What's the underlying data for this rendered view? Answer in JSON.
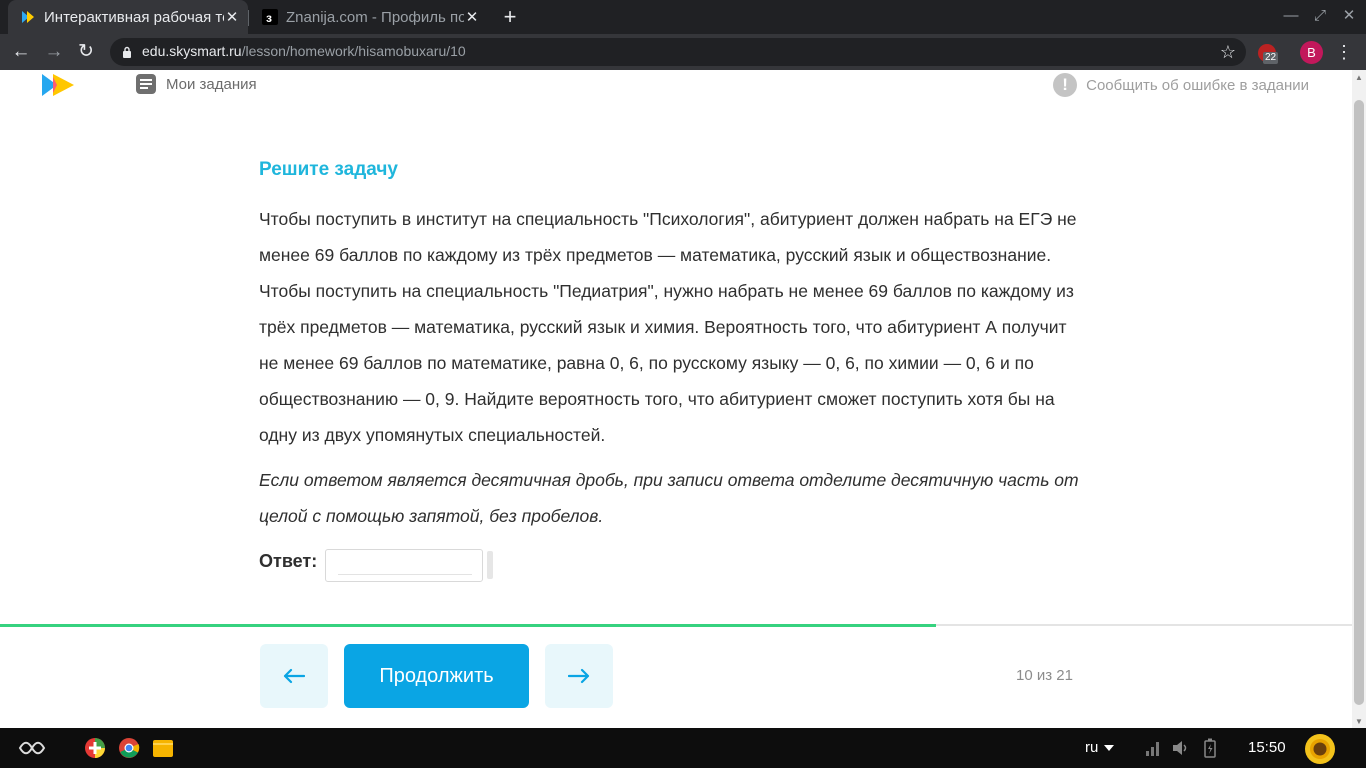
{
  "browser": {
    "tabs": [
      {
        "title": "Интерактивная рабочая тетрадь",
        "close": "✕",
        "active": true
      },
      {
        "title": "Znanija.com - Профиль пользователя",
        "close": "✕",
        "active": false
      }
    ],
    "new_tab": "+",
    "window_controls": {
      "minimize": "—",
      "restore": "⤢",
      "close": "✕"
    },
    "nav": {
      "back": "←",
      "forward": "→",
      "reload": "↻"
    },
    "address": {
      "host": "edu.skysmart.ru",
      "path": "/lesson/homework/hisamobuxaru/10"
    },
    "bookmark_star": "☆",
    "extension_badge": "22",
    "profile_initial": "B",
    "menu": "⋮"
  },
  "header": {
    "my_tasks": "Мои задания",
    "report_icon": "!",
    "report_error": "Сообщить об ошибке в задании"
  },
  "task": {
    "heading": "Решите задачу",
    "body": "Чтобы поступить в институт на специальность \"Психология\", абитуриент должен набрать на ЕГЭ не менее 69 баллов по каждому из трёх предметов — математика, русский язык и обществознание. Чтобы поступить на специальность \"Педиатрия\", нужно набрать не менее 69 баллов по каждому из трёх предметов — математика, русский язык и химия. Вероятность того, что абитуриент А получит не менее 69 баллов по математике, равна 0, 6, по русскому языку — 0, 6, по химии — 0, 6 и по обществознанию — 0, 9. Найдите вероятность того, что абитуриент сможет поступить хотя бы на одну из двух упомянутых специальностей.",
    "note": "Если ответом является десятичная дробь, при записи ответа отделите десятичную часть от целой с помощью запятой, без пробелов.",
    "answer_label": "Ответ:",
    "answer_value": ""
  },
  "progress": {
    "fraction": 0.692
  },
  "footer": {
    "continue_label": "Продолжить",
    "counter": "10 из 21"
  },
  "taskbar": {
    "language": "ru",
    "clock": "15:50"
  },
  "colors": {
    "accent": "#1fb6dc",
    "button": "#0aa5e4",
    "progress": "#36d27f"
  }
}
